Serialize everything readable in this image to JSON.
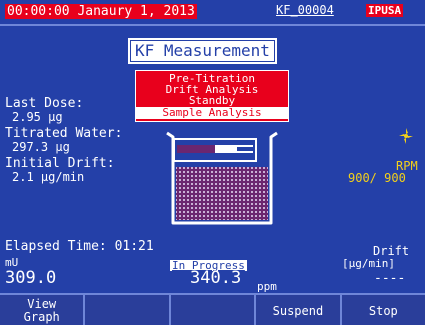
{
  "header": {
    "datetime": "00:00:00 Janaury 1, 2013",
    "method_id": "KF_00004",
    "flag_text": "IPUSA"
  },
  "title": "KF Measurement",
  "phases": [
    {
      "label": "Pre-Titration",
      "selected": false
    },
    {
      "label": "Drift Analysis",
      "selected": false
    },
    {
      "label": "Standby",
      "selected": false
    },
    {
      "label": "Sample Analysis",
      "selected": true
    }
  ],
  "stats": {
    "last_dose_label": "Last Dose:",
    "last_dose_value": "2.95 µg",
    "titrated_water_label": "Titrated Water:",
    "titrated_water_value": "297.3 µg",
    "initial_drift_label": "Initial Drift:",
    "initial_drift_value": "2.1 µg/min"
  },
  "stirrer": {
    "icon": "stirrer-icon",
    "rpm_label": "RPM",
    "rpm_value": "900/ 900"
  },
  "status": {
    "elapsed_label": "Elapsed Time: 01:21",
    "mv_label": "mU",
    "mv_value": "309.0",
    "progress_label": "In Progress",
    "ppm_value": "340.3",
    "ppm_unit": "ppm",
    "drift_label": "Drift",
    "drift_unit": "[µg/min]",
    "drift_value": "----"
  },
  "softkeys": [
    "View\nGraph",
    "",
    "",
    "Suspend",
    "Stop"
  ],
  "colors": {
    "background": "#2440a8",
    "highlight_red": "#e8001c",
    "rpm_yellow": "#f3d01a",
    "beaker_liquid": "#6b2670"
  }
}
